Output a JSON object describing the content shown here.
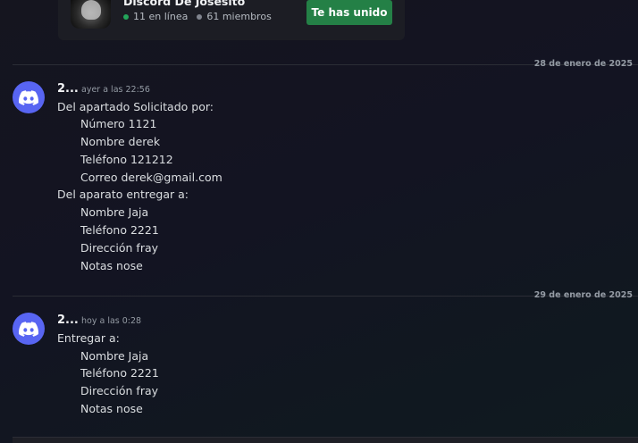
{
  "invite": {
    "server_name": "Discord De Josesito",
    "online": "11 en línea",
    "members": "61 miembros",
    "button_label": "Te has unido",
    "icon": "server-skull-icon"
  },
  "messages": [
    {
      "date_divider": "28 de enero de 2025",
      "author": "2...",
      "timestamp": "ayer a las 22:56",
      "avatar_icon": "discord-logo-icon",
      "lines": [
        {
          "text": "Del apartado Solicitado por:",
          "indent": 0
        },
        {
          "text": "Número 1121",
          "indent": 1
        },
        {
          "text": "Nombre derek",
          "indent": 1
        },
        {
          "text": "Teléfono 121212",
          "indent": 1
        },
        {
          "text": "Correo derek@gmail.com",
          "indent": 1
        },
        {
          "text": "Del aparato entregar a:",
          "indent": 0
        },
        {
          "text": "Nombre Jaja",
          "indent": 1
        },
        {
          "text": "Teléfono 2221",
          "indent": 1
        },
        {
          "text": "Dirección fray",
          "indent": 1
        },
        {
          "text": "Notas nose",
          "indent": 1
        }
      ]
    },
    {
      "date_divider": "29 de enero de 2025",
      "author": "2...",
      "timestamp": "hoy a las 0:28",
      "avatar_icon": "discord-logo-icon",
      "lines": [
        {
          "text": "Entregar a:",
          "indent": 0
        },
        {
          "text": "Nombre Jaja",
          "indent": 1
        },
        {
          "text": "Teléfono 2221",
          "indent": 1
        },
        {
          "text": "Dirección fray",
          "indent": 1
        },
        {
          "text": "Notas nose",
          "indent": 1
        }
      ]
    }
  ],
  "colors": {
    "accent": "#5865f2",
    "join_button": "#248046",
    "online_dot": "#23a55a"
  }
}
